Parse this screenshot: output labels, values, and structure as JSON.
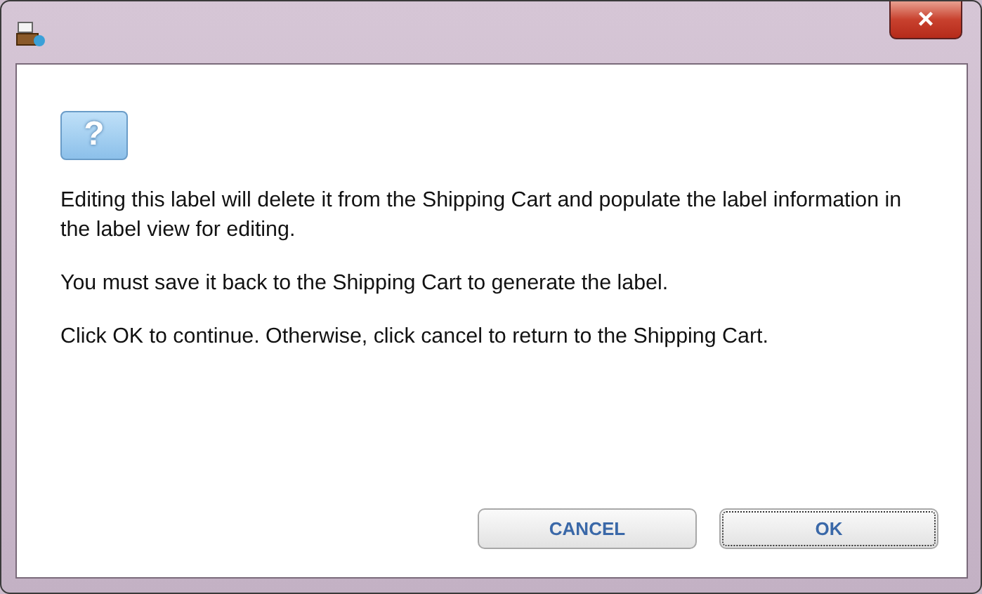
{
  "window": {
    "close_label": "×"
  },
  "dialog": {
    "icon": "?",
    "paragraphs": [
      "Editing this label will delete it from the Shipping Cart and populate the label information in the label view for editing.",
      "You must save it back to the Shipping Cart to generate the label.",
      "Click OK to continue. Otherwise, click cancel to return to the Shipping Cart."
    ]
  },
  "buttons": [
    {
      "label": "CANCEL",
      "focused": false
    },
    {
      "label": "OK",
      "focused": true
    }
  ]
}
